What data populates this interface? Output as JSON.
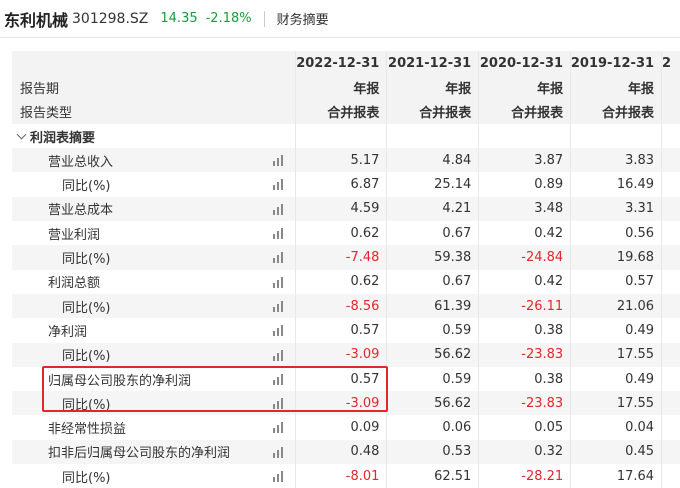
{
  "header": {
    "stock_name": "东利机械",
    "stock_code": "301298.SZ",
    "price": "14.35",
    "change": "-2.18%",
    "breadcrumb": "财务摘要",
    "accent_color": "#1a9a3c"
  },
  "table": {
    "header_rows": [
      {
        "label": "",
        "values": [
          "2022-12-31",
          "2021-12-31",
          "2020-12-31",
          "2019-12-31",
          "2"
        ]
      },
      {
        "label": "报告期",
        "values": [
          "年报",
          "年报",
          "年报",
          "年报",
          ""
        ]
      },
      {
        "label": "报告类型",
        "values": [
          "合并报表",
          "合并报表",
          "合并报表",
          "合并报表",
          ""
        ]
      }
    ],
    "section_title": "利润表摘要",
    "rows": [
      {
        "label": "营业总收入",
        "values": [
          "5.17",
          "4.84",
          "3.87",
          "3.83"
        ]
      },
      {
        "label": "同比(%)",
        "values": [
          "6.87",
          "25.14",
          "0.89",
          "16.49"
        ]
      },
      {
        "label": "营业总成本",
        "values": [
          "4.59",
          "4.21",
          "3.48",
          "3.31"
        ]
      },
      {
        "label": "营业利润",
        "values": [
          "0.62",
          "0.67",
          "0.42",
          "0.56"
        ]
      },
      {
        "label": "同比(%)",
        "values": [
          "-7.48",
          "59.38",
          "-24.84",
          "19.68"
        ]
      },
      {
        "label": "利润总额",
        "values": [
          "0.62",
          "0.67",
          "0.42",
          "0.57"
        ]
      },
      {
        "label": "同比(%)",
        "values": [
          "-8.56",
          "61.39",
          "-26.11",
          "21.06"
        ]
      },
      {
        "label": "净利润",
        "values": [
          "0.57",
          "0.59",
          "0.38",
          "0.49"
        ]
      },
      {
        "label": "同比(%)",
        "values": [
          "-3.09",
          "56.62",
          "-23.83",
          "17.55"
        ]
      },
      {
        "label": "归属母公司股东的净利润",
        "values": [
          "0.57",
          "0.59",
          "0.38",
          "0.49"
        ]
      },
      {
        "label": "同比(%)",
        "values": [
          "-3.09",
          "56.62",
          "-23.83",
          "17.55"
        ]
      },
      {
        "label": "非经常性损益",
        "values": [
          "0.09",
          "0.06",
          "0.05",
          "0.04"
        ]
      },
      {
        "label": "扣非后归属母公司股东的净利润",
        "values": [
          "0.48",
          "0.53",
          "0.32",
          "0.45"
        ]
      },
      {
        "label": "同比(%)",
        "values": [
          "-8.01",
          "62.51",
          "-28.21",
          "17.64"
        ]
      }
    ]
  }
}
